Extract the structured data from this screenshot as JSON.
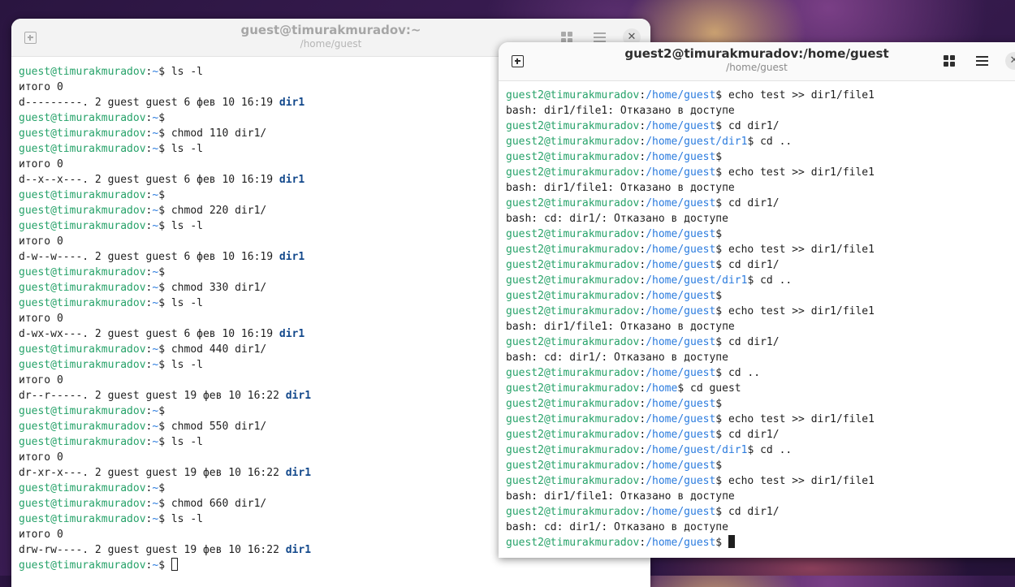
{
  "window_left": {
    "title": "guest@timurakmuradov:~",
    "subtitle": "/home/guest",
    "lines": [
      [
        [
          "u",
          "guest@timurakmuradov"
        ],
        [
          "t",
          ":"
        ],
        [
          "p",
          "~"
        ],
        [
          "t",
          "$ ls -l"
        ]
      ],
      [
        [
          "t",
          "итого 0"
        ]
      ],
      [
        [
          "t",
          "d---------. 2 guest guest 6 фев 10 16:19 "
        ],
        [
          "d",
          "dir1"
        ]
      ],
      [
        [
          "u",
          "guest@timurakmuradov"
        ],
        [
          "t",
          ":"
        ],
        [
          "p",
          "~"
        ],
        [
          "t",
          "$"
        ]
      ],
      [
        [
          "u",
          "guest@timurakmuradov"
        ],
        [
          "t",
          ":"
        ],
        [
          "p",
          "~"
        ],
        [
          "t",
          "$ chmod 110 dir1/"
        ]
      ],
      [
        [
          "u",
          "guest@timurakmuradov"
        ],
        [
          "t",
          ":"
        ],
        [
          "p",
          "~"
        ],
        [
          "t",
          "$ ls -l"
        ]
      ],
      [
        [
          "t",
          "итого 0"
        ]
      ],
      [
        [
          "t",
          "d--x--x---. 2 guest guest 6 фев 10 16:19 "
        ],
        [
          "d",
          "dir1"
        ]
      ],
      [
        [
          "u",
          "guest@timurakmuradov"
        ],
        [
          "t",
          ":"
        ],
        [
          "p",
          "~"
        ],
        [
          "t",
          "$"
        ]
      ],
      [
        [
          "u",
          "guest@timurakmuradov"
        ],
        [
          "t",
          ":"
        ],
        [
          "p",
          "~"
        ],
        [
          "t",
          "$ chmod 220 dir1/"
        ]
      ],
      [
        [
          "u",
          "guest@timurakmuradov"
        ],
        [
          "t",
          ":"
        ],
        [
          "p",
          "~"
        ],
        [
          "t",
          "$ ls -l"
        ]
      ],
      [
        [
          "t",
          "итого 0"
        ]
      ],
      [
        [
          "t",
          "d-w--w----. 2 guest guest 6 фев 10 16:19 "
        ],
        [
          "d",
          "dir1"
        ]
      ],
      [
        [
          "u",
          "guest@timurakmuradov"
        ],
        [
          "t",
          ":"
        ],
        [
          "p",
          "~"
        ],
        [
          "t",
          "$"
        ]
      ],
      [
        [
          "u",
          "guest@timurakmuradov"
        ],
        [
          "t",
          ":"
        ],
        [
          "p",
          "~"
        ],
        [
          "t",
          "$ chmod 330 dir1/"
        ]
      ],
      [
        [
          "u",
          "guest@timurakmuradov"
        ],
        [
          "t",
          ":"
        ],
        [
          "p",
          "~"
        ],
        [
          "t",
          "$ ls -l"
        ]
      ],
      [
        [
          "t",
          "итого 0"
        ]
      ],
      [
        [
          "t",
          "d-wx-wx---. 2 guest guest 6 фев 10 16:19 "
        ],
        [
          "d",
          "dir1"
        ]
      ],
      [
        [
          "u",
          "guest@timurakmuradov"
        ],
        [
          "t",
          ":"
        ],
        [
          "p",
          "~"
        ],
        [
          "t",
          "$ chmod 440 dir1/"
        ]
      ],
      [
        [
          "u",
          "guest@timurakmuradov"
        ],
        [
          "t",
          ":"
        ],
        [
          "p",
          "~"
        ],
        [
          "t",
          "$ ls -l"
        ]
      ],
      [
        [
          "t",
          "итого 0"
        ]
      ],
      [
        [
          "t",
          "dr--r-----. 2 guest guest 19 фев 10 16:22 "
        ],
        [
          "d",
          "dir1"
        ]
      ],
      [
        [
          "u",
          "guest@timurakmuradov"
        ],
        [
          "t",
          ":"
        ],
        [
          "p",
          "~"
        ],
        [
          "t",
          "$"
        ]
      ],
      [
        [
          "u",
          "guest@timurakmuradov"
        ],
        [
          "t",
          ":"
        ],
        [
          "p",
          "~"
        ],
        [
          "t",
          "$ chmod 550 dir1/"
        ]
      ],
      [
        [
          "u",
          "guest@timurakmuradov"
        ],
        [
          "t",
          ":"
        ],
        [
          "p",
          "~"
        ],
        [
          "t",
          "$ ls -l"
        ]
      ],
      [
        [
          "t",
          "итого 0"
        ]
      ],
      [
        [
          "t",
          "dr-xr-x---. 2 guest guest 19 фев 10 16:22 "
        ],
        [
          "d",
          "dir1"
        ]
      ],
      [
        [
          "u",
          "guest@timurakmuradov"
        ],
        [
          "t",
          ":"
        ],
        [
          "p",
          "~"
        ],
        [
          "t",
          "$"
        ]
      ],
      [
        [
          "u",
          "guest@timurakmuradov"
        ],
        [
          "t",
          ":"
        ],
        [
          "p",
          "~"
        ],
        [
          "t",
          "$ chmod 660 dir1/"
        ]
      ],
      [
        [
          "u",
          "guest@timurakmuradov"
        ],
        [
          "t",
          ":"
        ],
        [
          "p",
          "~"
        ],
        [
          "t",
          "$ ls -l"
        ]
      ],
      [
        [
          "t",
          "итого 0"
        ]
      ],
      [
        [
          "t",
          "drw-rw----. 2 guest guest 19 фев 10 16:22 "
        ],
        [
          "d",
          "dir1"
        ]
      ],
      [
        [
          "u",
          "guest@timurakmuradov"
        ],
        [
          "t",
          ":"
        ],
        [
          "p",
          "~"
        ],
        [
          "t",
          "$ "
        ],
        [
          "c",
          "hollow"
        ]
      ]
    ]
  },
  "window_right": {
    "title": "guest2@timurakmuradov:/home/guest",
    "subtitle": "/home/guest",
    "lines": [
      [
        [
          "u",
          "guest2@timurakmuradov"
        ],
        [
          "t",
          ":"
        ],
        [
          "p",
          "/home/guest"
        ],
        [
          "t",
          "$ echo test >> dir1/file1"
        ]
      ],
      [
        [
          "t",
          "bash: dir1/file1: Отказано в доступе"
        ]
      ],
      [
        [
          "u",
          "guest2@timurakmuradov"
        ],
        [
          "t",
          ":"
        ],
        [
          "p",
          "/home/guest"
        ],
        [
          "t",
          "$ cd dir1/"
        ]
      ],
      [
        [
          "u",
          "guest2@timurakmuradov"
        ],
        [
          "t",
          ":"
        ],
        [
          "p",
          "/home/guest/dir1"
        ],
        [
          "t",
          "$ cd .."
        ]
      ],
      [
        [
          "u",
          "guest2@timurakmuradov"
        ],
        [
          "t",
          ":"
        ],
        [
          "p",
          "/home/guest"
        ],
        [
          "t",
          "$"
        ]
      ],
      [
        [
          "u",
          "guest2@timurakmuradov"
        ],
        [
          "t",
          ":"
        ],
        [
          "p",
          "/home/guest"
        ],
        [
          "t",
          "$ echo test >> dir1/file1"
        ]
      ],
      [
        [
          "t",
          "bash: dir1/file1: Отказано в доступе"
        ]
      ],
      [
        [
          "u",
          "guest2@timurakmuradov"
        ],
        [
          "t",
          ":"
        ],
        [
          "p",
          "/home/guest"
        ],
        [
          "t",
          "$ cd dir1/"
        ]
      ],
      [
        [
          "t",
          "bash: cd: dir1/: Отказано в доступе"
        ]
      ],
      [
        [
          "u",
          "guest2@timurakmuradov"
        ],
        [
          "t",
          ":"
        ],
        [
          "p",
          "/home/guest"
        ],
        [
          "t",
          "$"
        ]
      ],
      [
        [
          "u",
          "guest2@timurakmuradov"
        ],
        [
          "t",
          ":"
        ],
        [
          "p",
          "/home/guest"
        ],
        [
          "t",
          "$ echo test >> dir1/file1"
        ]
      ],
      [
        [
          "u",
          "guest2@timurakmuradov"
        ],
        [
          "t",
          ":"
        ],
        [
          "p",
          "/home/guest"
        ],
        [
          "t",
          "$ cd dir1/"
        ]
      ],
      [
        [
          "u",
          "guest2@timurakmuradov"
        ],
        [
          "t",
          ":"
        ],
        [
          "p",
          "/home/guest/dir1"
        ],
        [
          "t",
          "$ cd .."
        ]
      ],
      [
        [
          "u",
          "guest2@timurakmuradov"
        ],
        [
          "t",
          ":"
        ],
        [
          "p",
          "/home/guest"
        ],
        [
          "t",
          "$"
        ]
      ],
      [
        [
          "u",
          "guest2@timurakmuradov"
        ],
        [
          "t",
          ":"
        ],
        [
          "p",
          "/home/guest"
        ],
        [
          "t",
          "$ echo test >> dir1/file1"
        ]
      ],
      [
        [
          "t",
          "bash: dir1/file1: Отказано в доступе"
        ]
      ],
      [
        [
          "u",
          "guest2@timurakmuradov"
        ],
        [
          "t",
          ":"
        ],
        [
          "p",
          "/home/guest"
        ],
        [
          "t",
          "$ cd dir1/"
        ]
      ],
      [
        [
          "t",
          "bash: cd: dir1/: Отказано в доступе"
        ]
      ],
      [
        [
          "u",
          "guest2@timurakmuradov"
        ],
        [
          "t",
          ":"
        ],
        [
          "p",
          "/home/guest"
        ],
        [
          "t",
          "$ cd .."
        ]
      ],
      [
        [
          "u",
          "guest2@timurakmuradov"
        ],
        [
          "t",
          ":"
        ],
        [
          "p",
          "/home"
        ],
        [
          "t",
          "$ cd guest"
        ]
      ],
      [
        [
          "u",
          "guest2@timurakmuradov"
        ],
        [
          "t",
          ":"
        ],
        [
          "p",
          "/home/guest"
        ],
        [
          "t",
          "$"
        ]
      ],
      [
        [
          "u",
          "guest2@timurakmuradov"
        ],
        [
          "t",
          ":"
        ],
        [
          "p",
          "/home/guest"
        ],
        [
          "t",
          "$ echo test >> dir1/file1"
        ]
      ],
      [
        [
          "u",
          "guest2@timurakmuradov"
        ],
        [
          "t",
          ":"
        ],
        [
          "p",
          "/home/guest"
        ],
        [
          "t",
          "$ cd dir1/"
        ]
      ],
      [
        [
          "u",
          "guest2@timurakmuradov"
        ],
        [
          "t",
          ":"
        ],
        [
          "p",
          "/home/guest/dir1"
        ],
        [
          "t",
          "$ cd .."
        ]
      ],
      [
        [
          "u",
          "guest2@timurakmuradov"
        ],
        [
          "t",
          ":"
        ],
        [
          "p",
          "/home/guest"
        ],
        [
          "t",
          "$"
        ]
      ],
      [
        [
          "u",
          "guest2@timurakmuradov"
        ],
        [
          "t",
          ":"
        ],
        [
          "p",
          "/home/guest"
        ],
        [
          "t",
          "$ echo test >> dir1/file1"
        ]
      ],
      [
        [
          "t",
          "bash: dir1/file1: Отказано в доступе"
        ]
      ],
      [
        [
          "u",
          "guest2@timurakmuradov"
        ],
        [
          "t",
          ":"
        ],
        [
          "p",
          "/home/guest"
        ],
        [
          "t",
          "$ cd dir1/"
        ]
      ],
      [
        [
          "t",
          "bash: cd: dir1/: Отказано в доступе"
        ]
      ],
      [
        [
          "u",
          "guest2@timurakmuradov"
        ],
        [
          "t",
          ":"
        ],
        [
          "p",
          "/home/guest"
        ],
        [
          "t",
          "$ "
        ],
        [
          "c",
          "block"
        ]
      ]
    ]
  }
}
